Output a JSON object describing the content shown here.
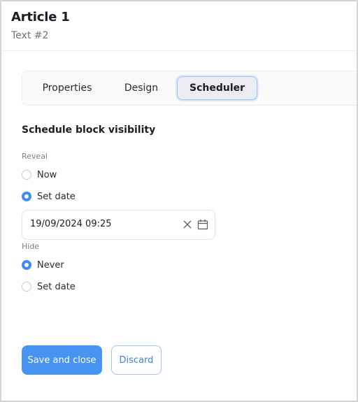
{
  "header": {
    "title": "Article 1",
    "subtitle": "Text #2"
  },
  "tabs": [
    {
      "label": "Properties",
      "active": false
    },
    {
      "label": "Design",
      "active": false
    },
    {
      "label": "Scheduler",
      "active": true
    }
  ],
  "scheduler": {
    "section_title": "Schedule block visibility",
    "reveal": {
      "label": "Reveal",
      "options": [
        {
          "label": "Now",
          "checked": false
        },
        {
          "label": "Set date",
          "checked": true
        }
      ],
      "date_value": "19/09/2024 09:25",
      "clear_icon": "close-icon",
      "calendar_icon": "calendar-icon"
    },
    "hide": {
      "label": "Hide",
      "options": [
        {
          "label": "Never",
          "checked": true
        },
        {
          "label": "Set date",
          "checked": false
        }
      ]
    }
  },
  "actions": {
    "save_label": "Save and close",
    "discard_label": "Discard"
  },
  "colors": {
    "accent": "#4894f3",
    "radio_checked": "#3d8cf0",
    "tab_active_bg": "#ececf3",
    "tab_active_border": "#9fc3f5"
  }
}
